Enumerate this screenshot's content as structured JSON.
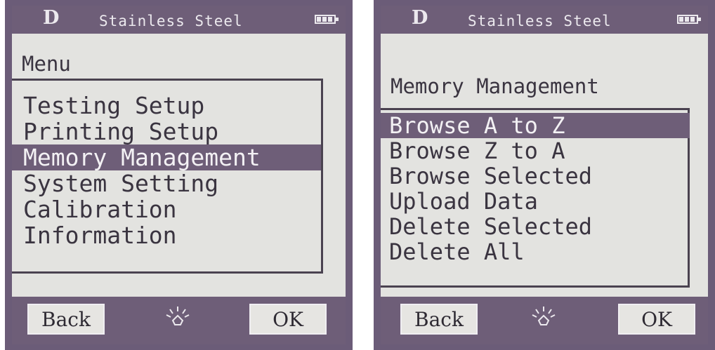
{
  "left_screen": {
    "mode": "D",
    "material": "Stainless Steel",
    "heading": "Menu",
    "items": [
      {
        "label": "Testing Setup",
        "selected": false
      },
      {
        "label": "Printing Setup",
        "selected": false
      },
      {
        "label": "Memory Management",
        "selected": true
      },
      {
        "label": "System Setting",
        "selected": false
      },
      {
        "label": "Calibration",
        "selected": false
      },
      {
        "label": "Information",
        "selected": false
      }
    ],
    "softkeys": {
      "left": "Back",
      "right": "OK"
    },
    "icons": {
      "battery": "battery-icon",
      "center": "backlight-icon"
    }
  },
  "right_screen": {
    "mode": "D",
    "material": "Stainless Steel",
    "heading": "Memory Management",
    "items": [
      {
        "label": "Browse A to Z",
        "selected": true
      },
      {
        "label": "Browse Z to A",
        "selected": false
      },
      {
        "label": "Browse Selected",
        "selected": false
      },
      {
        "label": "Upload Data",
        "selected": false
      },
      {
        "label": "Delete Selected",
        "selected": false
      },
      {
        "label": "Delete All",
        "selected": false
      }
    ],
    "softkeys": {
      "left": "Back",
      "right": "OK"
    },
    "icons": {
      "battery": "battery-icon",
      "center": "backlight-icon"
    }
  },
  "colors": {
    "lcd_background": "#e3e3e0",
    "bar": "#6e5e78",
    "text": "#3a3440"
  }
}
